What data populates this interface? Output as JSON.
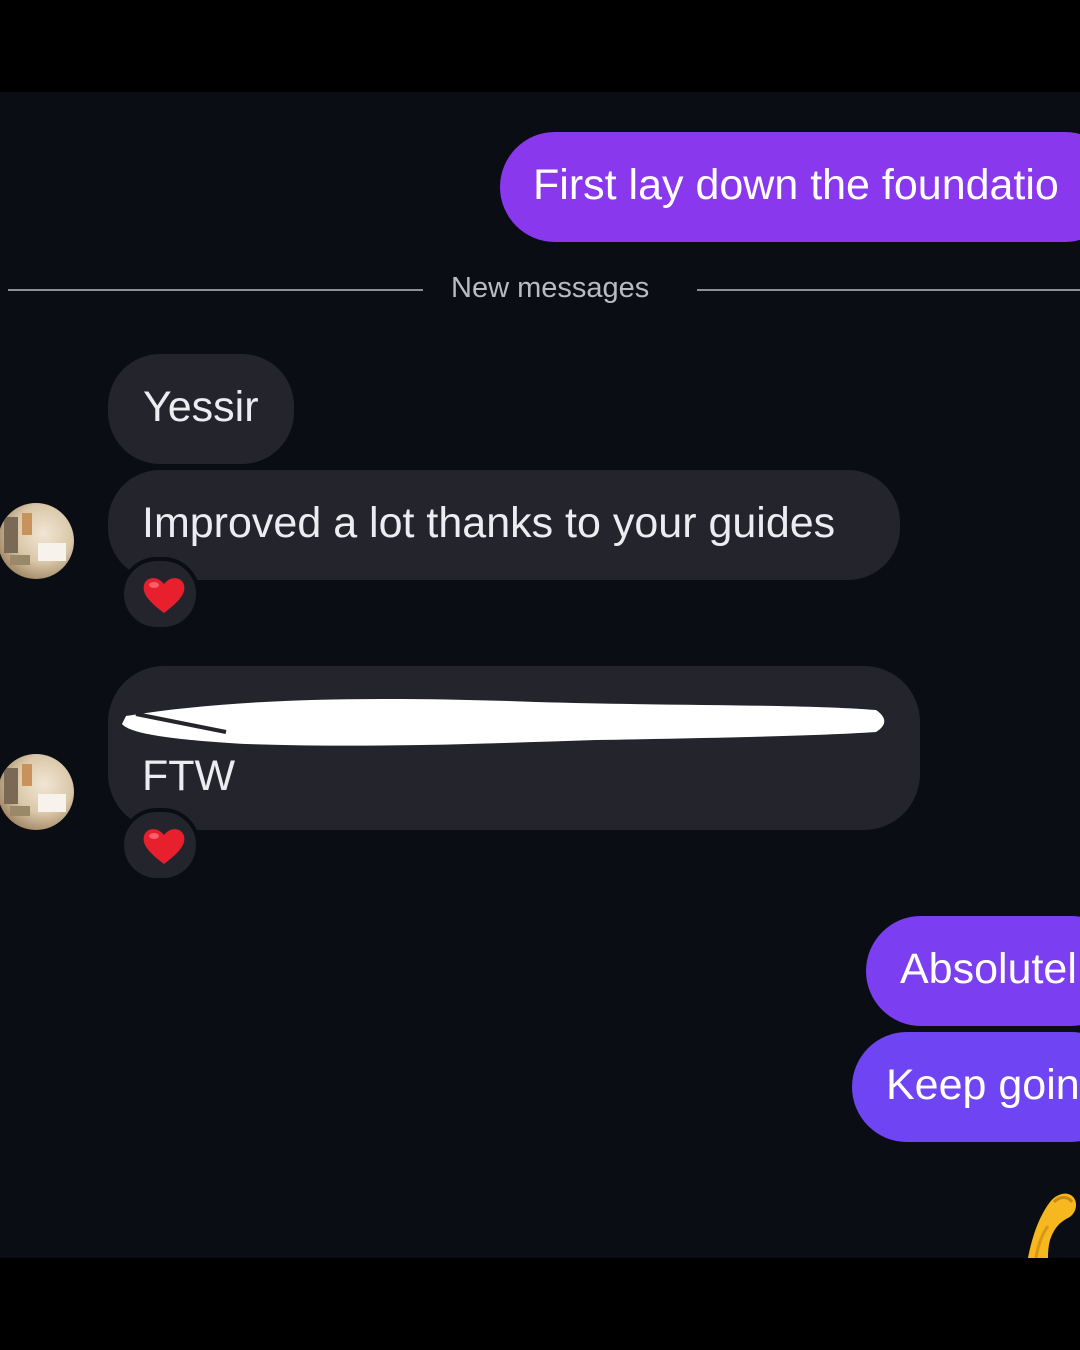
{
  "chat": {
    "messages": {
      "sent_1": "First lay down the foundatio",
      "received_1": "Yessir",
      "received_2": "Improved a lot thanks to your guides",
      "received_3_line2": "FTW",
      "sent_2": "Absolutel",
      "sent_3": "Keep goin"
    },
    "divider_label": "New messages",
    "reactions": {
      "received_2": "heart-icon",
      "received_3": "heart-icon"
    },
    "trailing_emoji": "flexed-biceps-icon"
  },
  "colors": {
    "background": "#0b0d14",
    "sent_bubble": "#8a38ee",
    "received_bubble": "#24252c",
    "heart": "#e8202e"
  }
}
